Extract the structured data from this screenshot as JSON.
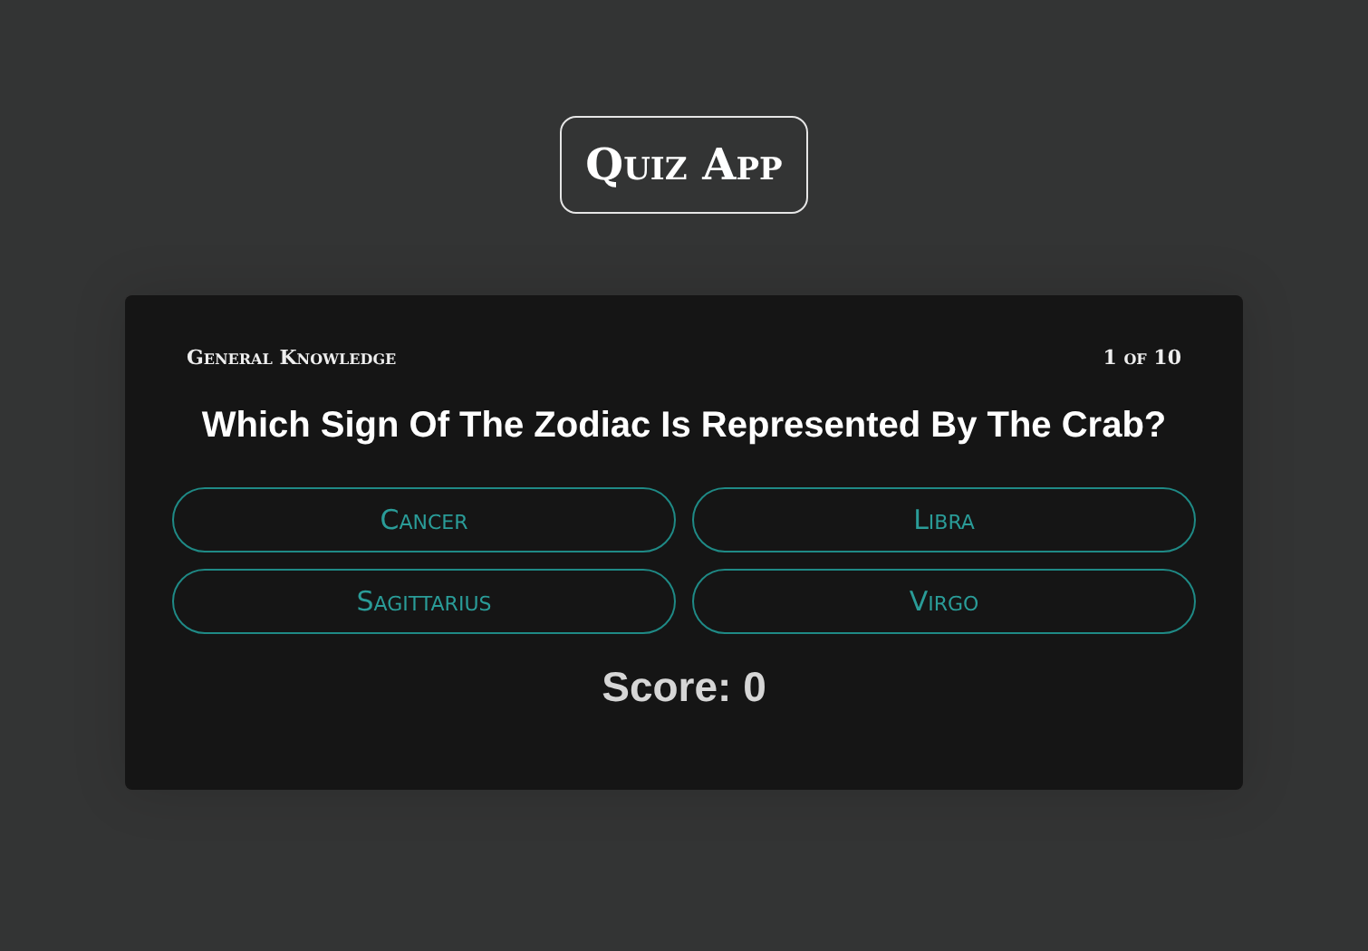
{
  "app_title": "Quiz App",
  "quiz": {
    "category": "General Knowledge",
    "progress": "1 of 10",
    "question": "Which Sign Of The Zodiac Is Represented By The Crab?",
    "answers": [
      "Cancer",
      "Libra",
      "Sagittarius",
      "Virgo"
    ],
    "score": "Score: 0"
  }
}
